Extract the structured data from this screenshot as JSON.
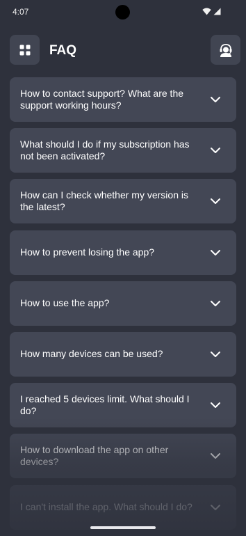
{
  "status_bar": {
    "time": "4:07",
    "icons": [
      "wifi-icon",
      "signal-icon"
    ]
  },
  "header": {
    "title": "FAQ",
    "menu_icon": "grid-icon",
    "support_icon": "headset-agent-icon"
  },
  "faq": {
    "items": [
      {
        "question": "How to contact support? What are the support working hours?"
      },
      {
        "question": "What should I do if my subscription has not been activated?"
      },
      {
        "question": "How can I check whether my version is the latest?"
      },
      {
        "question": "How to prevent losing the app?"
      },
      {
        "question": "How to use the app?"
      },
      {
        "question": "How many devices can be used?"
      },
      {
        "question": "I reached 5 devices limit. What should I do?"
      },
      {
        "question": "How to download the app on other devices?"
      },
      {
        "question": "I can't install the app. What should I do?"
      }
    ],
    "expand_icon": "chevron-down-icon"
  },
  "colors": {
    "background": "#2e313c",
    "card": "#434755",
    "button": "#414552",
    "text": "#ffffff"
  }
}
